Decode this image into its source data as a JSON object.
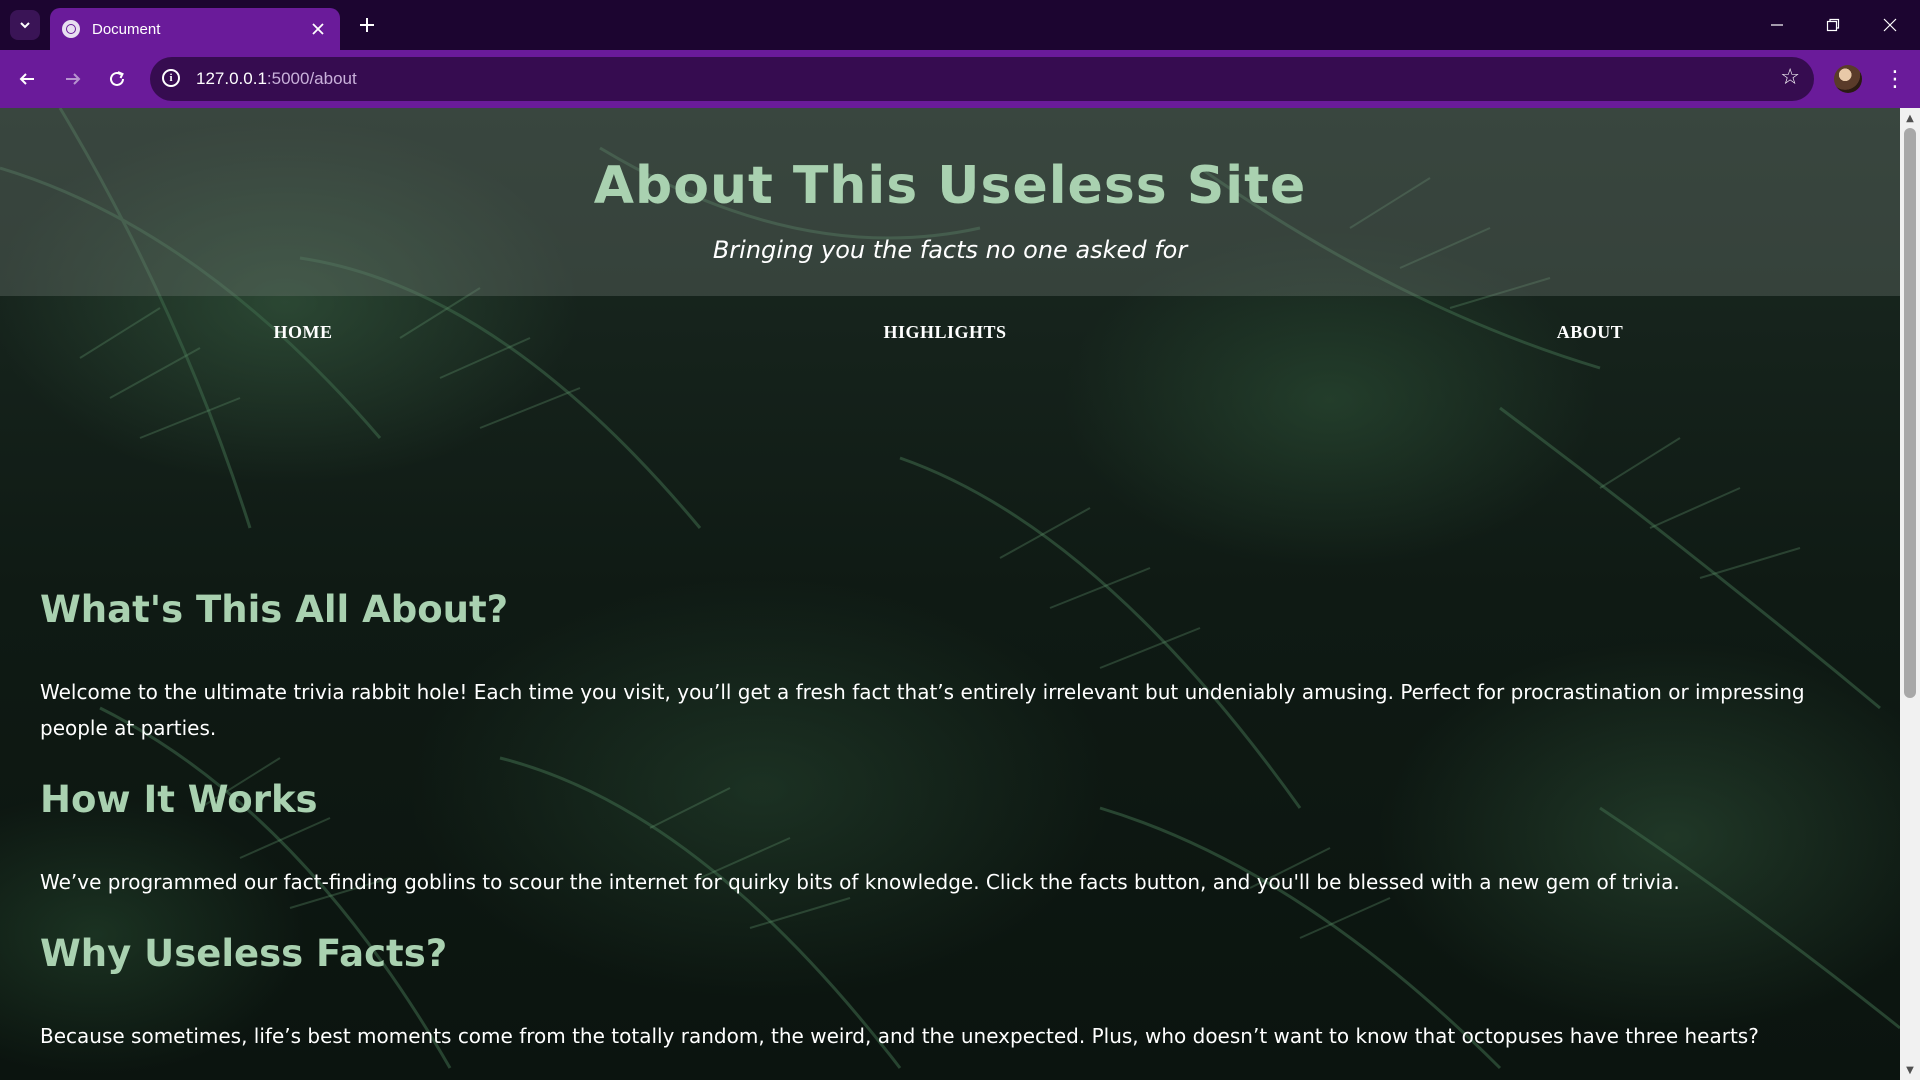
{
  "browser": {
    "tab_title": "Document",
    "url_host": "127.0.0.1",
    "url_rest": ":5000/about",
    "icons": {
      "tab_search": "chevron-down-icon",
      "favicon": "globe-icon",
      "close": "close-icon",
      "new_tab": "plus-icon",
      "back": "arrow-left-icon",
      "forward": "arrow-right-icon",
      "reload": "reload-icon",
      "site_info": "info-icon",
      "bookmark": "star-icon",
      "menu": "kebab-menu-icon"
    },
    "accent_color": "#6a1b9a"
  },
  "header": {
    "title": "About This Useless Site",
    "tagline": "Bringing you the facts no one asked for"
  },
  "nav": {
    "items": [
      {
        "label": "HOME"
      },
      {
        "label": "HIGHLIGHTS"
      },
      {
        "label": "ABOUT"
      }
    ]
  },
  "sections": [
    {
      "heading": "What's This All About?",
      "text": "Welcome to the ultimate trivia rabbit hole! Each time you visit, you’ll get a fresh fact that’s entirely irrelevant but undeniably amusing. Perfect for procrastination or impressing people at parties."
    },
    {
      "heading": "How It Works",
      "text": "We’ve programmed our fact-finding goblins to scour the internet for quirky bits of knowledge. Click the facts button, and you'll be blessed with a new gem of trivia."
    },
    {
      "heading": "Why Useless Facts?",
      "text": "Because sometimes, life’s best moments come from the totally random, the weird, and the unexpected. Plus, who doesn’t want to know that octopuses have three hearts?"
    }
  ],
  "colors": {
    "heading": "#a9d1b0",
    "body_text": "#ffffff"
  }
}
